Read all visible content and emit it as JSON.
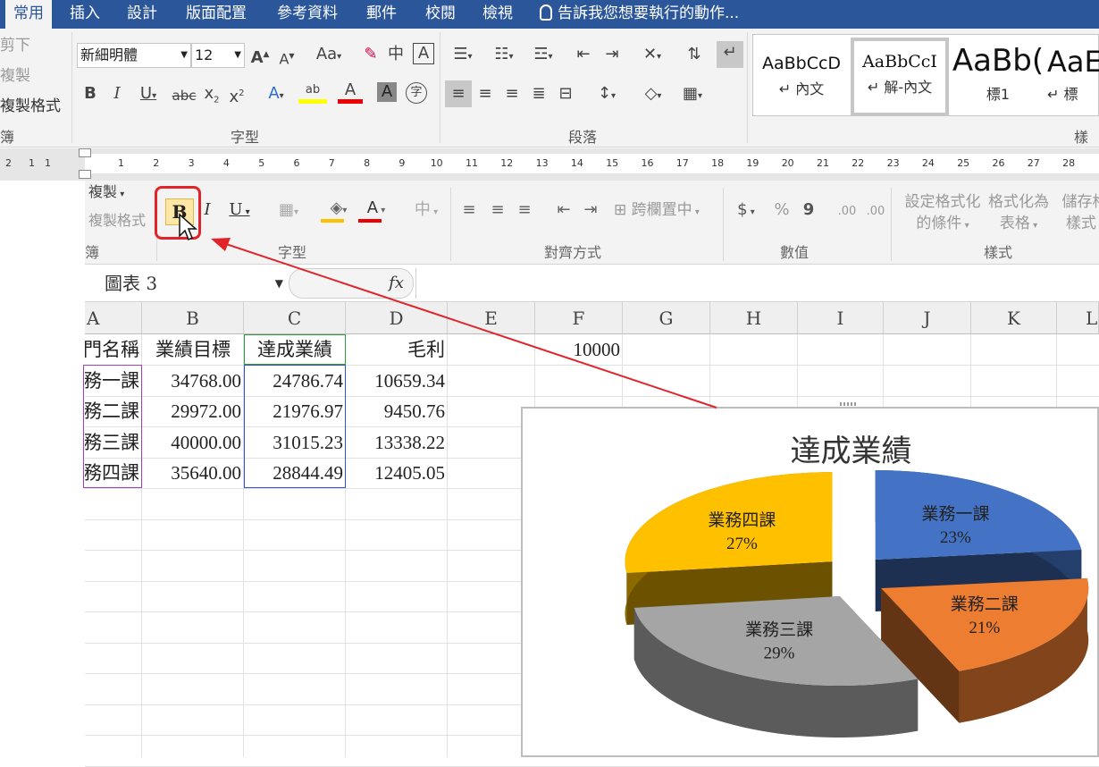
{
  "tabs": [
    {
      "label": "常用",
      "active": true
    },
    {
      "label": "插入"
    },
    {
      "label": "設計"
    },
    {
      "label": "版面配置"
    },
    {
      "label": "參考資料"
    },
    {
      "label": "郵件"
    },
    {
      "label": "校閱"
    },
    {
      "label": "檢視"
    }
  ],
  "tell_me": "告訴我您想要執行的動作...",
  "word_ribbon": {
    "clipboard": {
      "cut": "剪下",
      "copy": "複製",
      "format_painter": "複製格式",
      "group": "簿"
    },
    "font": {
      "name": "新細明體",
      "size": "12",
      "group": "字型",
      "aa": "Aa"
    },
    "paragraph": {
      "group": "段落"
    },
    "styles": {
      "group": "樣式",
      "items": [
        {
          "sample": "AaBbCcD",
          "name": "↵ 內文"
        },
        {
          "sample": "AaBbCcI",
          "name": "↵ 解-內文"
        },
        {
          "sample": "AaBb(",
          "name": "標1"
        },
        {
          "sample": "AaE",
          "name": "↵ 標"
        }
      ]
    }
  },
  "ruler": {
    "left": [
      "2",
      "1",
      "1"
    ],
    "numbers": [
      "1",
      "2",
      "3",
      "4",
      "5",
      "6",
      "7",
      "8",
      "9",
      "10",
      "11",
      "12",
      "13",
      "14",
      "15",
      "16",
      "17",
      "18",
      "19",
      "20",
      "21",
      "22",
      "23",
      "24",
      "25",
      "26",
      "27",
      "28"
    ]
  },
  "excel_ribbon": {
    "copy": "複製",
    "format_painter": "複製格式",
    "clipboard_group": "簿",
    "font_group": "字型",
    "alignment_group": "對齊方式",
    "number_group": "數值",
    "styles_group": "樣式",
    "merge_center": "跨欄置中",
    "cond_format_1": "設定格式化",
    "cond_format_2": "的條件",
    "format_table_1": "格式化為",
    "format_table_2": "表格",
    "cell_styles_1": "儲存格",
    "cell_styles_2": "樣式",
    "currency": "$",
    "percent": "%",
    "comma": "9",
    "font_color_letter": "A",
    "chinese_phonetic": "中",
    "bold": "B",
    "italic": "I",
    "underline": "U"
  },
  "formula_bar": {
    "name_box": "圖表 3",
    "fx": "fx",
    "formula": ""
  },
  "columns": [
    "A",
    "B",
    "C",
    "D",
    "E",
    "F",
    "G",
    "H",
    "I",
    "J",
    "K",
    "L"
  ],
  "table": {
    "headers": [
      "門名稱",
      "業績目標",
      "達成業績",
      "毛利"
    ],
    "f1": "10000",
    "rows": [
      [
        "務一課",
        "34768.00",
        "24786.74",
        "10659.34"
      ],
      [
        "務二課",
        "29972.00",
        "21976.97",
        "9450.76"
      ],
      [
        "務三課",
        "40000.00",
        "31015.23",
        "13338.22"
      ],
      [
        "務四課",
        "35640.00",
        "28844.49",
        "12405.05"
      ]
    ]
  },
  "chart_data": {
    "type": "pie",
    "title": "達成業績",
    "categories": [
      "業務一課",
      "業務二課",
      "業務三課",
      "業務四課"
    ],
    "values": [
      24786.74,
      21976.97,
      31015.23,
      28844.49
    ],
    "labels": [
      "23%",
      "21%",
      "29%",
      "27%"
    ],
    "colors": [
      "#4472c4",
      "#ed7d31",
      "#a5a5a5",
      "#ffc000"
    ],
    "style": "3d-exploded"
  }
}
